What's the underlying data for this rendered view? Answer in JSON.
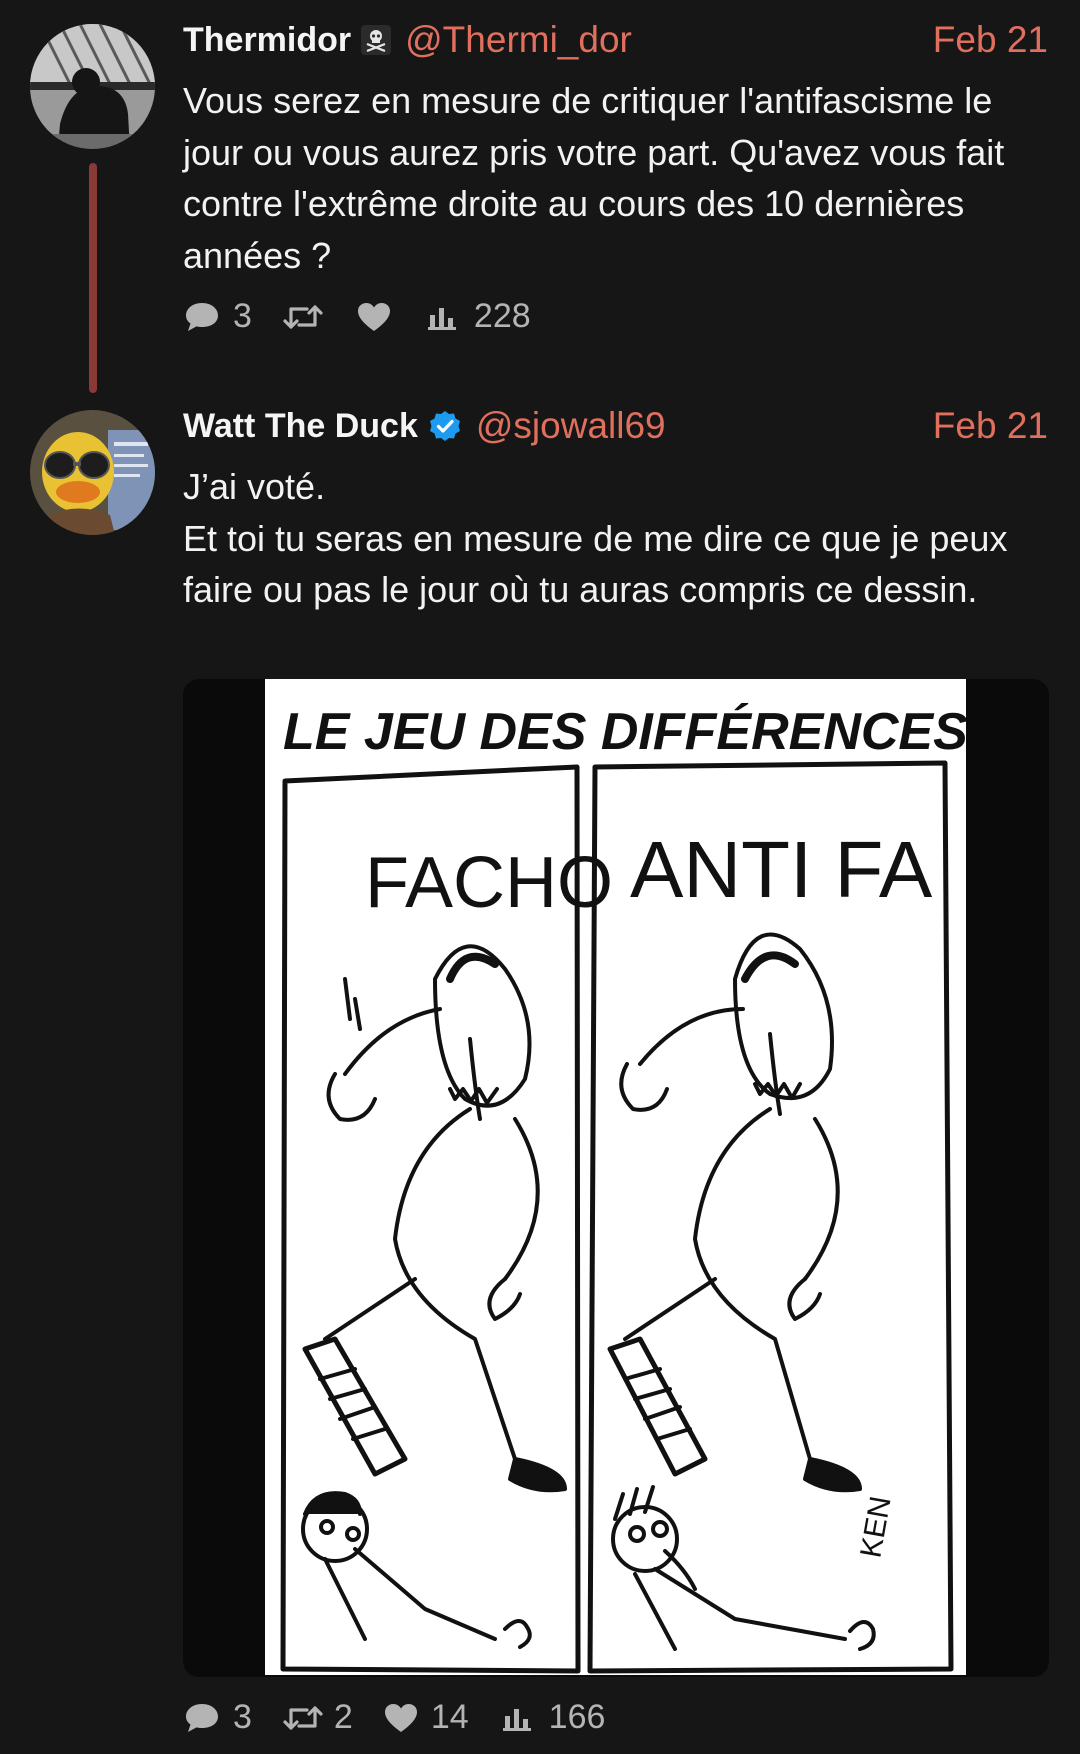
{
  "tweets": [
    {
      "author": {
        "name": "Thermidor",
        "handle": "@Thermi_dor",
        "badge": "skull-crossbones-icon",
        "avatar": "cat-on-balcony-photo"
      },
      "date": "Feb 21",
      "text_lines": [
        "Vous serez en mesure de critiquer l'antifascisme le jour ou vous aurez pris votre part. Qu'avez vous fait contre l'extrême droite au cours des 10 dernières années ?"
      ],
      "stats": {
        "replies": "3",
        "retweets": "",
        "likes": "",
        "views": "228"
      }
    },
    {
      "author": {
        "name": "Watt The Duck",
        "handle": "@sjowall69",
        "badge": "verified-icon",
        "avatar": "duck-with-sunglasses"
      },
      "date": "Feb 21",
      "text_lines": [
        "J’ai voté.",
        "Et toi tu seras en mesure de me dire ce que je peux faire ou pas le jour où tu auras compris ce dessin."
      ],
      "image": {
        "title": "LE JEU DES DIFFÉRENCES",
        "left_label": "FACHO",
        "right_label": "ANTI FA",
        "signature": "KEN"
      },
      "stats": {
        "replies": "3",
        "retweets": "2",
        "likes": "14",
        "views": "166"
      }
    }
  ],
  "colors": {
    "background": "#161616",
    "accent": "#e0705d",
    "thread_line": "#8a3a36",
    "verified": "#1d9bf0",
    "muted": "#b4b4b4"
  }
}
